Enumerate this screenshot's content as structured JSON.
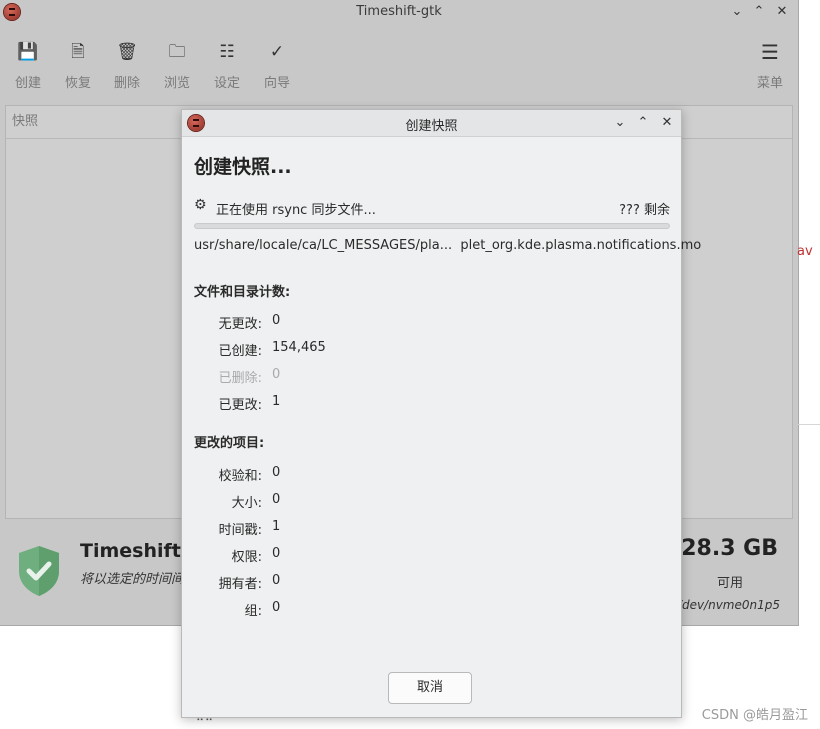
{
  "main_window": {
    "title": "Timeshift-gtk",
    "toolbar": [
      {
        "icon": "save-icon",
        "glyph": "💾",
        "label": "创建"
      },
      {
        "icon": "restore-icon",
        "glyph": "🗎",
        "label": "恢复"
      },
      {
        "icon": "delete-icon",
        "glyph": "🗑",
        "label": "删除"
      },
      {
        "icon": "folder-icon",
        "glyph": "🗀",
        "label": "浏览"
      },
      {
        "icon": "settings-icon",
        "glyph": "☷",
        "label": "设定"
      },
      {
        "icon": "wizard-icon",
        "glyph": "✓",
        "label": "向导"
      }
    ],
    "menu": {
      "icon": "menu-icon",
      "glyph": "☰",
      "label": "菜单"
    },
    "snapshot_column_header": "快照",
    "status_title": "Timeshift已",
    "status_subtitle": "将以选定的时间间",
    "free_space": "128.3 GB",
    "free_label": "可用",
    "device": "/dev/nvme0n1p5",
    "peek_text": "av"
  },
  "dialog": {
    "title": "创建快照",
    "heading": "创建快照...",
    "status": "正在使用 rsync 同步文件...",
    "remaining": "??? 剩余",
    "progress": 0.0,
    "file_path": "usr/share/locale/ca/LC_MESSAGES/pla...  plet_org.kde.plasma.notifications.mo",
    "section_counts": "文件和目录计数:",
    "counts": [
      {
        "label": "无更改:",
        "value": "0",
        "disabled": false
      },
      {
        "label": "已创建:",
        "value": "154,465",
        "disabled": false
      },
      {
        "label": "已删除:",
        "value": "0",
        "disabled": true
      },
      {
        "label": "已更改:",
        "value": "1",
        "disabled": false
      }
    ],
    "section_changed": "更改的项目:",
    "changed": [
      {
        "label": "校验和:",
        "value": "0"
      },
      {
        "label": "大小:",
        "value": "0"
      },
      {
        "label": "时间戳:",
        "value": "1"
      },
      {
        "label": "权限:",
        "value": "0"
      },
      {
        "label": "拥有者:",
        "value": "0"
      },
      {
        "label": "组:",
        "value": "0"
      }
    ],
    "cancel_label": "取消"
  },
  "watermark": "CSDN @皓月盈江",
  "colors": {
    "accent": "#3daee9",
    "shield": "#6fae7e"
  }
}
